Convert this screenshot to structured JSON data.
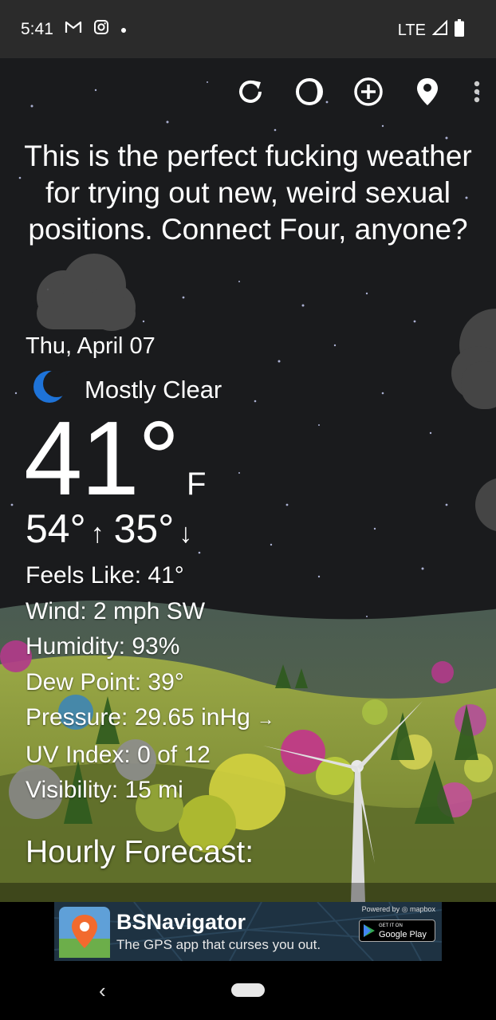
{
  "status_bar": {
    "time": "5:41",
    "network": "LTE",
    "notification_icons": [
      "gmail-icon",
      "instagram-icon",
      "dot-icon"
    ]
  },
  "toolbar": {
    "icons": [
      "refresh-icon",
      "moon-phase-icon",
      "add-location-icon",
      "location-pin-icon",
      "more-vert-icon"
    ]
  },
  "quote": "This is the perfect fucking weather for trying out new, weird sexual positions. Connect Four, anyone?",
  "weather": {
    "date": "Thu, April 07",
    "condition": "Mostly Clear",
    "condition_icon": "crescent-moon-icon",
    "temperature": "41°",
    "unit": "F",
    "high": "54°",
    "low": "35°",
    "high_arrow": "↑",
    "low_arrow": "↓"
  },
  "details": {
    "feels_like": "Feels Like:  41°",
    "wind": "Wind:  2 mph SW",
    "humidity": "Humidity:  93%",
    "dew_point": "Dew Point:  39°",
    "pressure": "Pressure:  29.65 inHg",
    "pressure_trend": "→",
    "uv_index": "UV Index:  0 of 12",
    "visibility": "Visibility:  15 mi"
  },
  "hourly_heading": "Hourly Forecast:",
  "ad": {
    "title": "BSNavigator",
    "subtitle": "The GPS app that curses you out.",
    "powered_by": "Powered by ◎ mapbox",
    "play_small": "GET IT ON",
    "play_label": "Google Play"
  },
  "nav": {
    "back_glyph": "‹"
  },
  "colors": {
    "status_bar": "#2b2b2b",
    "sky": "#1a1b1d",
    "hill": "#8a9a3c",
    "moon": "#1e73d8"
  }
}
